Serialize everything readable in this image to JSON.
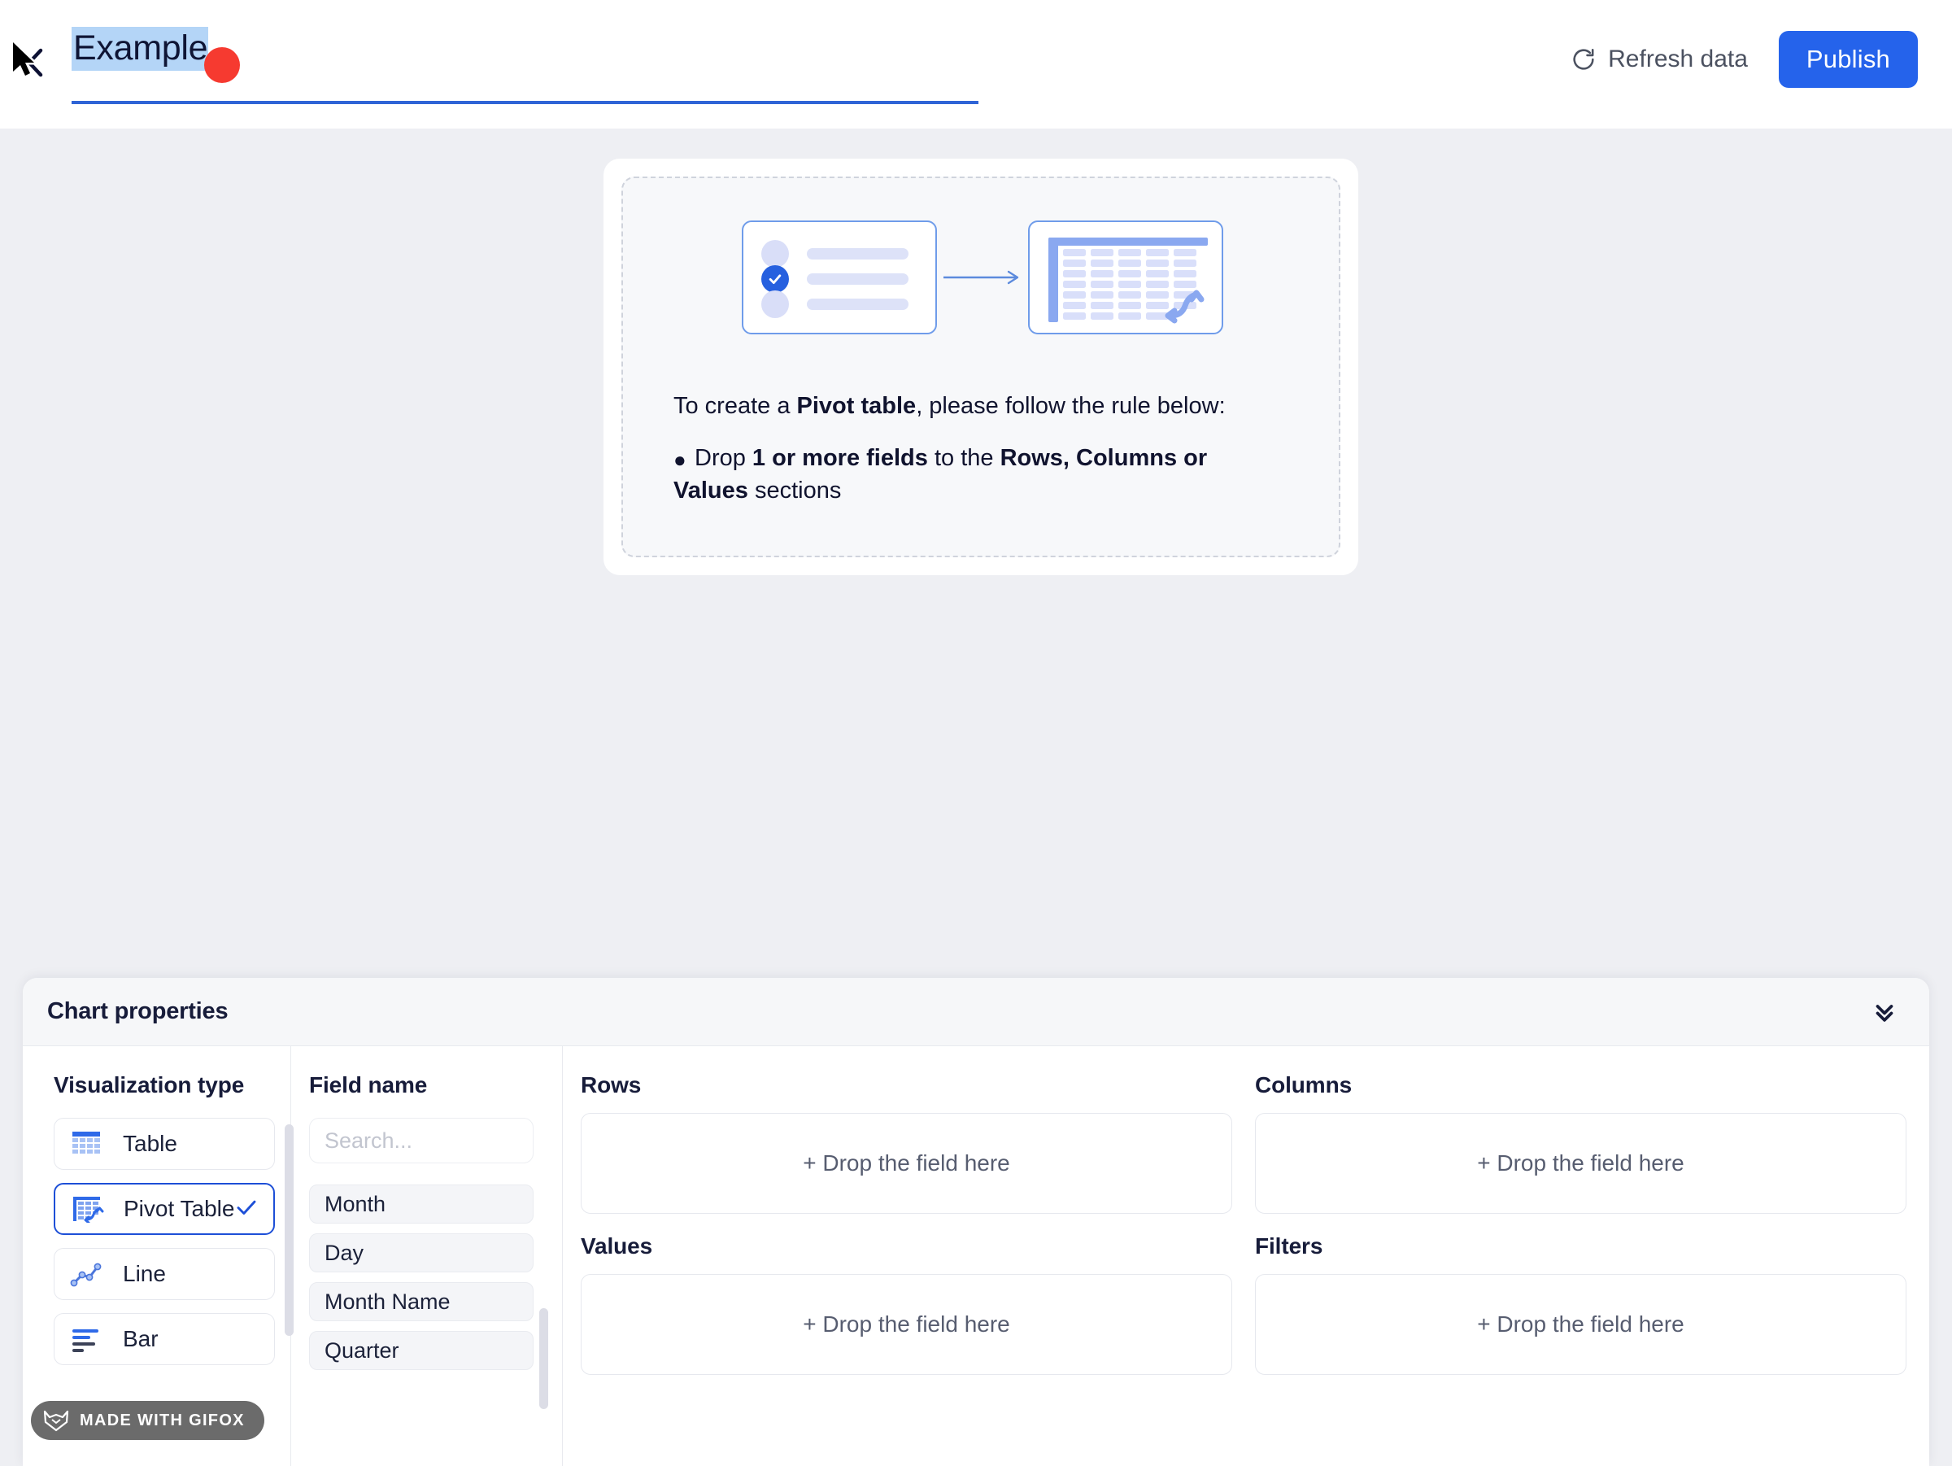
{
  "header": {
    "collapse_icon": "chevron-left-icon",
    "title_value": "Example",
    "refresh_label": "Refresh data",
    "refresh_icon": "refresh-icon",
    "publish_label": "Publish",
    "accent_color": "#2563eb",
    "selection_color": "#b4d5f7",
    "underline_color": "#2f64d6"
  },
  "canvas": {
    "empty_state": {
      "illustration": {
        "left_icon": "field-list-icon",
        "arrow_icon": "arrow-right-icon",
        "right_icon": "pivot-table-icon"
      },
      "intro_prefix": "To create a ",
      "intro_strong": "Pivot table",
      "intro_suffix": ", please follow the rule below:",
      "bullet_glyph": "●",
      "rule_part1": "Drop ",
      "rule_strong1": "1 or more fields",
      "rule_part2": " to the ",
      "rule_strong2": "Rows, Columns or Values",
      "rule_part3": " sections"
    }
  },
  "properties": {
    "panel_title": "Chart properties",
    "collapse_icon": "chevrons-down-icon",
    "visualization": {
      "section_title": "Visualization type",
      "selected": "Pivot Table",
      "check_icon": "check-icon",
      "items": [
        {
          "label": "Table",
          "icon": "table-icon",
          "selected": false
        },
        {
          "label": "Pivot Table",
          "icon": "pivot-table-icon",
          "selected": true
        },
        {
          "label": "Line",
          "icon": "line-chart-icon",
          "selected": false
        },
        {
          "label": "Bar",
          "icon": "bar-chart-icon",
          "selected": false
        }
      ]
    },
    "fields": {
      "section_title": "Field name",
      "search_placeholder": "Search...",
      "search_value": "",
      "items": [
        "Month",
        "Day",
        "Month Name",
        "Quarter"
      ]
    },
    "dropzones": {
      "placeholder": "+ Drop the field here",
      "rows_label": "Rows",
      "columns_label": "Columns",
      "values_label": "Values",
      "filters_label": "Filters"
    }
  },
  "overlay": {
    "cursor_icon": "mouse-pointer-icon",
    "click_indicator_color": "#f63a30",
    "watermark_text": "MADE WITH GIFOX",
    "watermark_icon": "fox-icon"
  }
}
